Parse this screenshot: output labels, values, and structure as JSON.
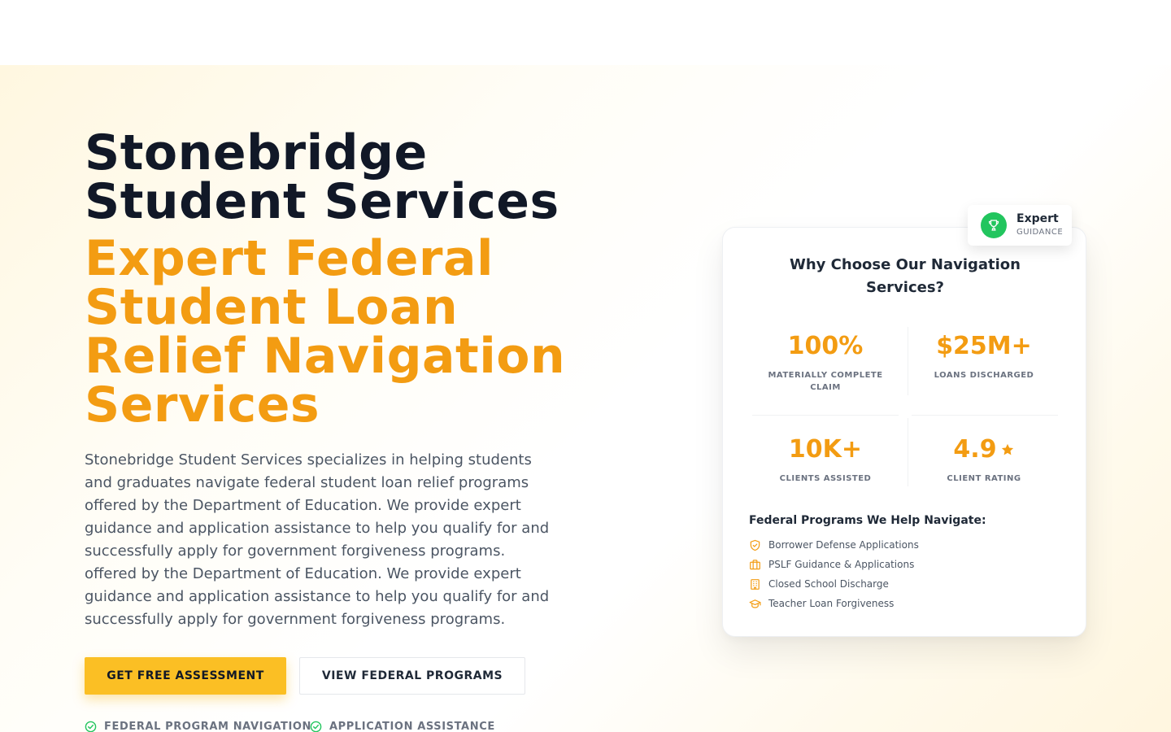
{
  "hero": {
    "title_line1": "Stonebridge",
    "title_line2": "Student Services",
    "subtitle_line1": "Expert Federal",
    "subtitle_line2": "Student Loan",
    "subtitle_line3": "Relief Navigation",
    "subtitle_line4": "Services",
    "description_lines": [
      "Stonebridge Student Services specializes in helping students",
      "and graduates navigate federal student loan relief programs",
      "offered by the Department of Education. We provide expert",
      "guidance and application assistance to help you qualify for and",
      "successfully apply for government forgiveness programs.",
      "offered by the Department of Education. We provide expert",
      "guidance and application assistance to help you qualify for and",
      "successfully apply for government forgiveness programs."
    ],
    "primary_button": "GET FREE ASSESSMENT",
    "secondary_button": "VIEW FEDERAL PROGRAMS",
    "features": [
      "FEDERAL PROGRAM NAVIGATION",
      "APPLICATION ASSISTANCE"
    ]
  },
  "badge": {
    "title": "Expert",
    "subtitle": "GUIDANCE",
    "icon": "trophy-icon"
  },
  "card": {
    "title": "Why Choose Our Navigation Services?",
    "stats": [
      {
        "value": "100%",
        "label": "MATERIALLY COMPLETE CLAIM"
      },
      {
        "value": "$25M+",
        "label": "LOANS DISCHARGED"
      },
      {
        "value": "10K+",
        "label": "CLIENTS ASSISTED"
      },
      {
        "value": "4.9",
        "label": "CLIENT RATING",
        "icon": "star-icon"
      }
    ],
    "programs_title": "Federal Programs We Help Navigate:",
    "programs": [
      {
        "label": "Borrower Defense Applications",
        "icon": "shield-check-icon"
      },
      {
        "label": "PSLF Guidance & Applications",
        "icon": "briefcase-icon"
      },
      {
        "label": "Closed School Discharge",
        "icon": "building-icon"
      },
      {
        "label": "Teacher Loan Forgiveness",
        "icon": "graduation-cap-icon"
      }
    ]
  },
  "colors": {
    "accent": "#f39c12",
    "button": "#fbbf24",
    "dark": "#111827",
    "badge_green": "#22c55e"
  }
}
